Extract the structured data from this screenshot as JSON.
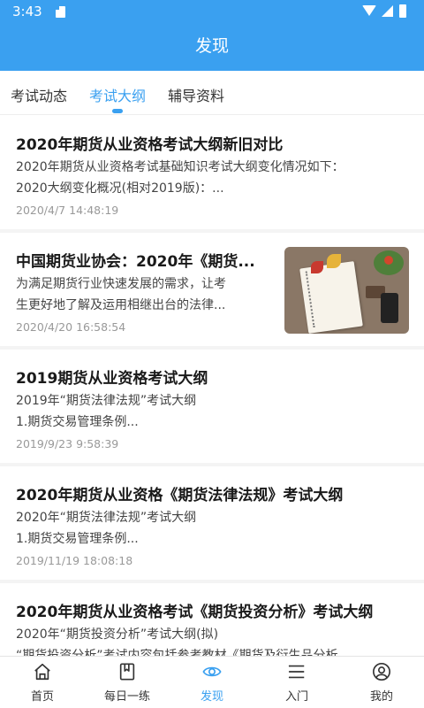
{
  "status_bar": {
    "time": "3:43"
  },
  "app_bar": {
    "title": "发现"
  },
  "tabs": [
    {
      "label": "考试动态",
      "active": false
    },
    {
      "label": "考试大纲",
      "active": true
    },
    {
      "label": "辅导资料",
      "active": false
    }
  ],
  "articles": [
    {
      "title": "2020年期货从业资格考试大纲新旧对比",
      "summary_line1": "2020年期货从业资格考试基础知识考试大纲变化情况如下：",
      "summary_line2": "2020大纲变化概况(相对2019版)：...",
      "date": "2020/4/7 14:48:19"
    },
    {
      "title": "中国期货业协会：2020年《期货...",
      "summary_line1": "为满足期货行业快速发展的需求，让考",
      "summary_line2": "生更好地了解及运用相继出台的法律...",
      "date": "2020/4/20 16:58:54",
      "thumbnail": "notebook-desk-photo"
    },
    {
      "title": "2019期货从业资格考试大纲",
      "summary_line1": "2019年“期货法律法规”考试大纲",
      "summary_line2": "1.期货交易管理条例...",
      "date": "2019/9/23 9:58:39"
    },
    {
      "title": "2020年期货从业资格《期货法律法规》考试大纲",
      "summary_line1": "2020年“期货法律法规”考试大纲",
      "summary_line2": "1.期货交易管理条例...",
      "date": "2019/11/19 18:08:18"
    },
    {
      "title": "2020年期货从业资格考试《期货投资分析》考试大纲",
      "summary_line1": "2020年“期货投资分析”考试大纲(拟)",
      "summary_line2": "“期货投资分析”考试内容包括参考教材《期货及衍生品分析",
      "date": ""
    }
  ],
  "bottom_nav": [
    {
      "label": "首页",
      "icon": "home-icon",
      "active": false
    },
    {
      "label": "每日一练",
      "icon": "bookmark-book-icon",
      "active": false
    },
    {
      "label": "发现",
      "icon": "eye-icon",
      "active": true
    },
    {
      "label": "入门",
      "icon": "list-icon",
      "active": false
    },
    {
      "label": "我的",
      "icon": "user-icon",
      "active": false
    }
  ],
  "colors": {
    "accent": "#3aa0f0",
    "text": "#1a1a1a",
    "muted": "#999999",
    "divider": "#f4f4f4"
  }
}
